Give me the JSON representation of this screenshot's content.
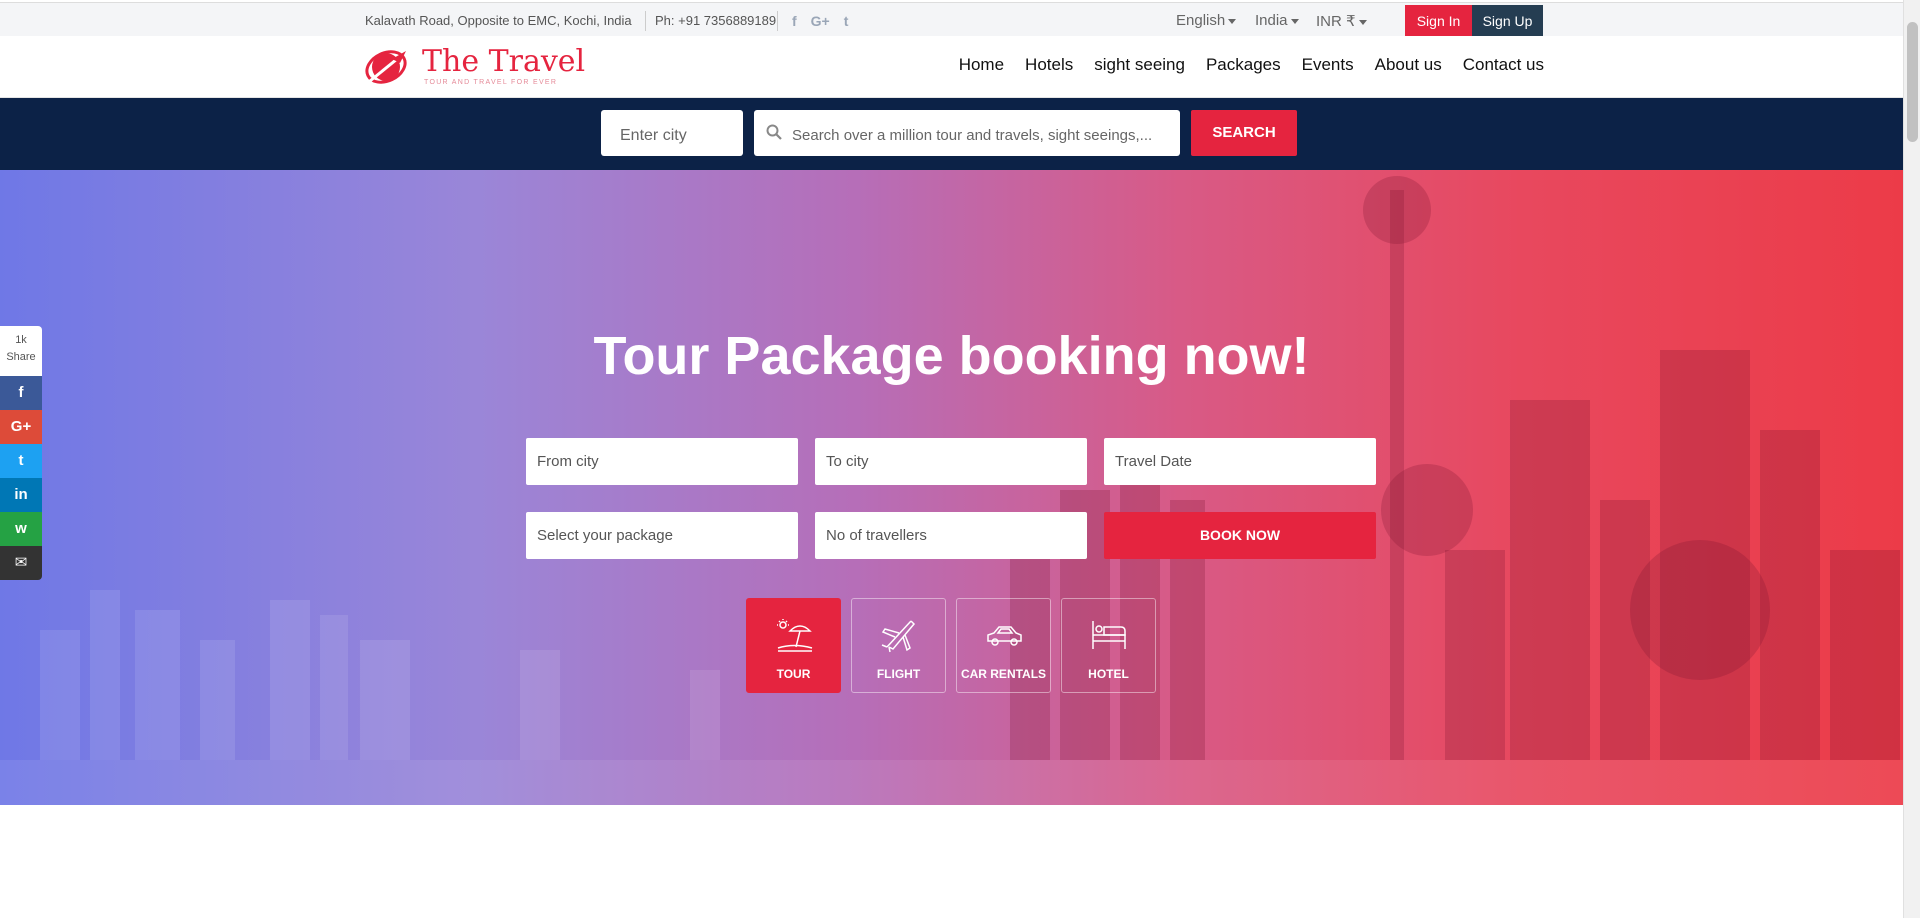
{
  "topbar": {
    "address": "Kalavath Road, Opposite to EMC, Kochi, India",
    "phone": "Ph: +91 7356889189",
    "social_icons": [
      "facebook-icon",
      "google-plus-icon",
      "twitter-icon"
    ],
    "social_glyphs": {
      "facebook": "f",
      "google_plus": "G+",
      "twitter": "t"
    },
    "language": "English",
    "country": "India",
    "currency": "INR ₹",
    "sign_in": "Sign In",
    "sign_up": "Sign Up"
  },
  "header": {
    "logo_name": "The Travel",
    "logo_tagline": "TOUR AND TRAVEL FOR EVER",
    "nav": [
      "Home",
      "Hotels",
      "sight seeing",
      "Packages",
      "Events",
      "About us",
      "Contact us"
    ]
  },
  "search": {
    "city_placeholder": "Enter city",
    "query_placeholder": "Search over a million tour and travels, sight seeings,...",
    "button": "SEARCH"
  },
  "hero": {
    "title": "Tour Package booking now!",
    "from_city": "From city",
    "to_city": "To city",
    "travel_date": "Travel Date",
    "package": "Select your package",
    "travellers": "No of travellers",
    "book_button": "BOOK NOW",
    "categories": [
      "TOUR",
      "FLIGHT",
      "CAR RENTALS",
      "HOTEL"
    ],
    "active_category": "TOUR"
  },
  "share": {
    "count": "1k",
    "label": "Share",
    "glyphs": {
      "facebook": "f",
      "google_plus": "G+",
      "twitter": "t",
      "linkedin": "in",
      "whatsapp": "w",
      "email": "✉"
    }
  },
  "colors": {
    "accent": "#e5243f",
    "navy": "#0c2247",
    "signup": "#253d52"
  }
}
